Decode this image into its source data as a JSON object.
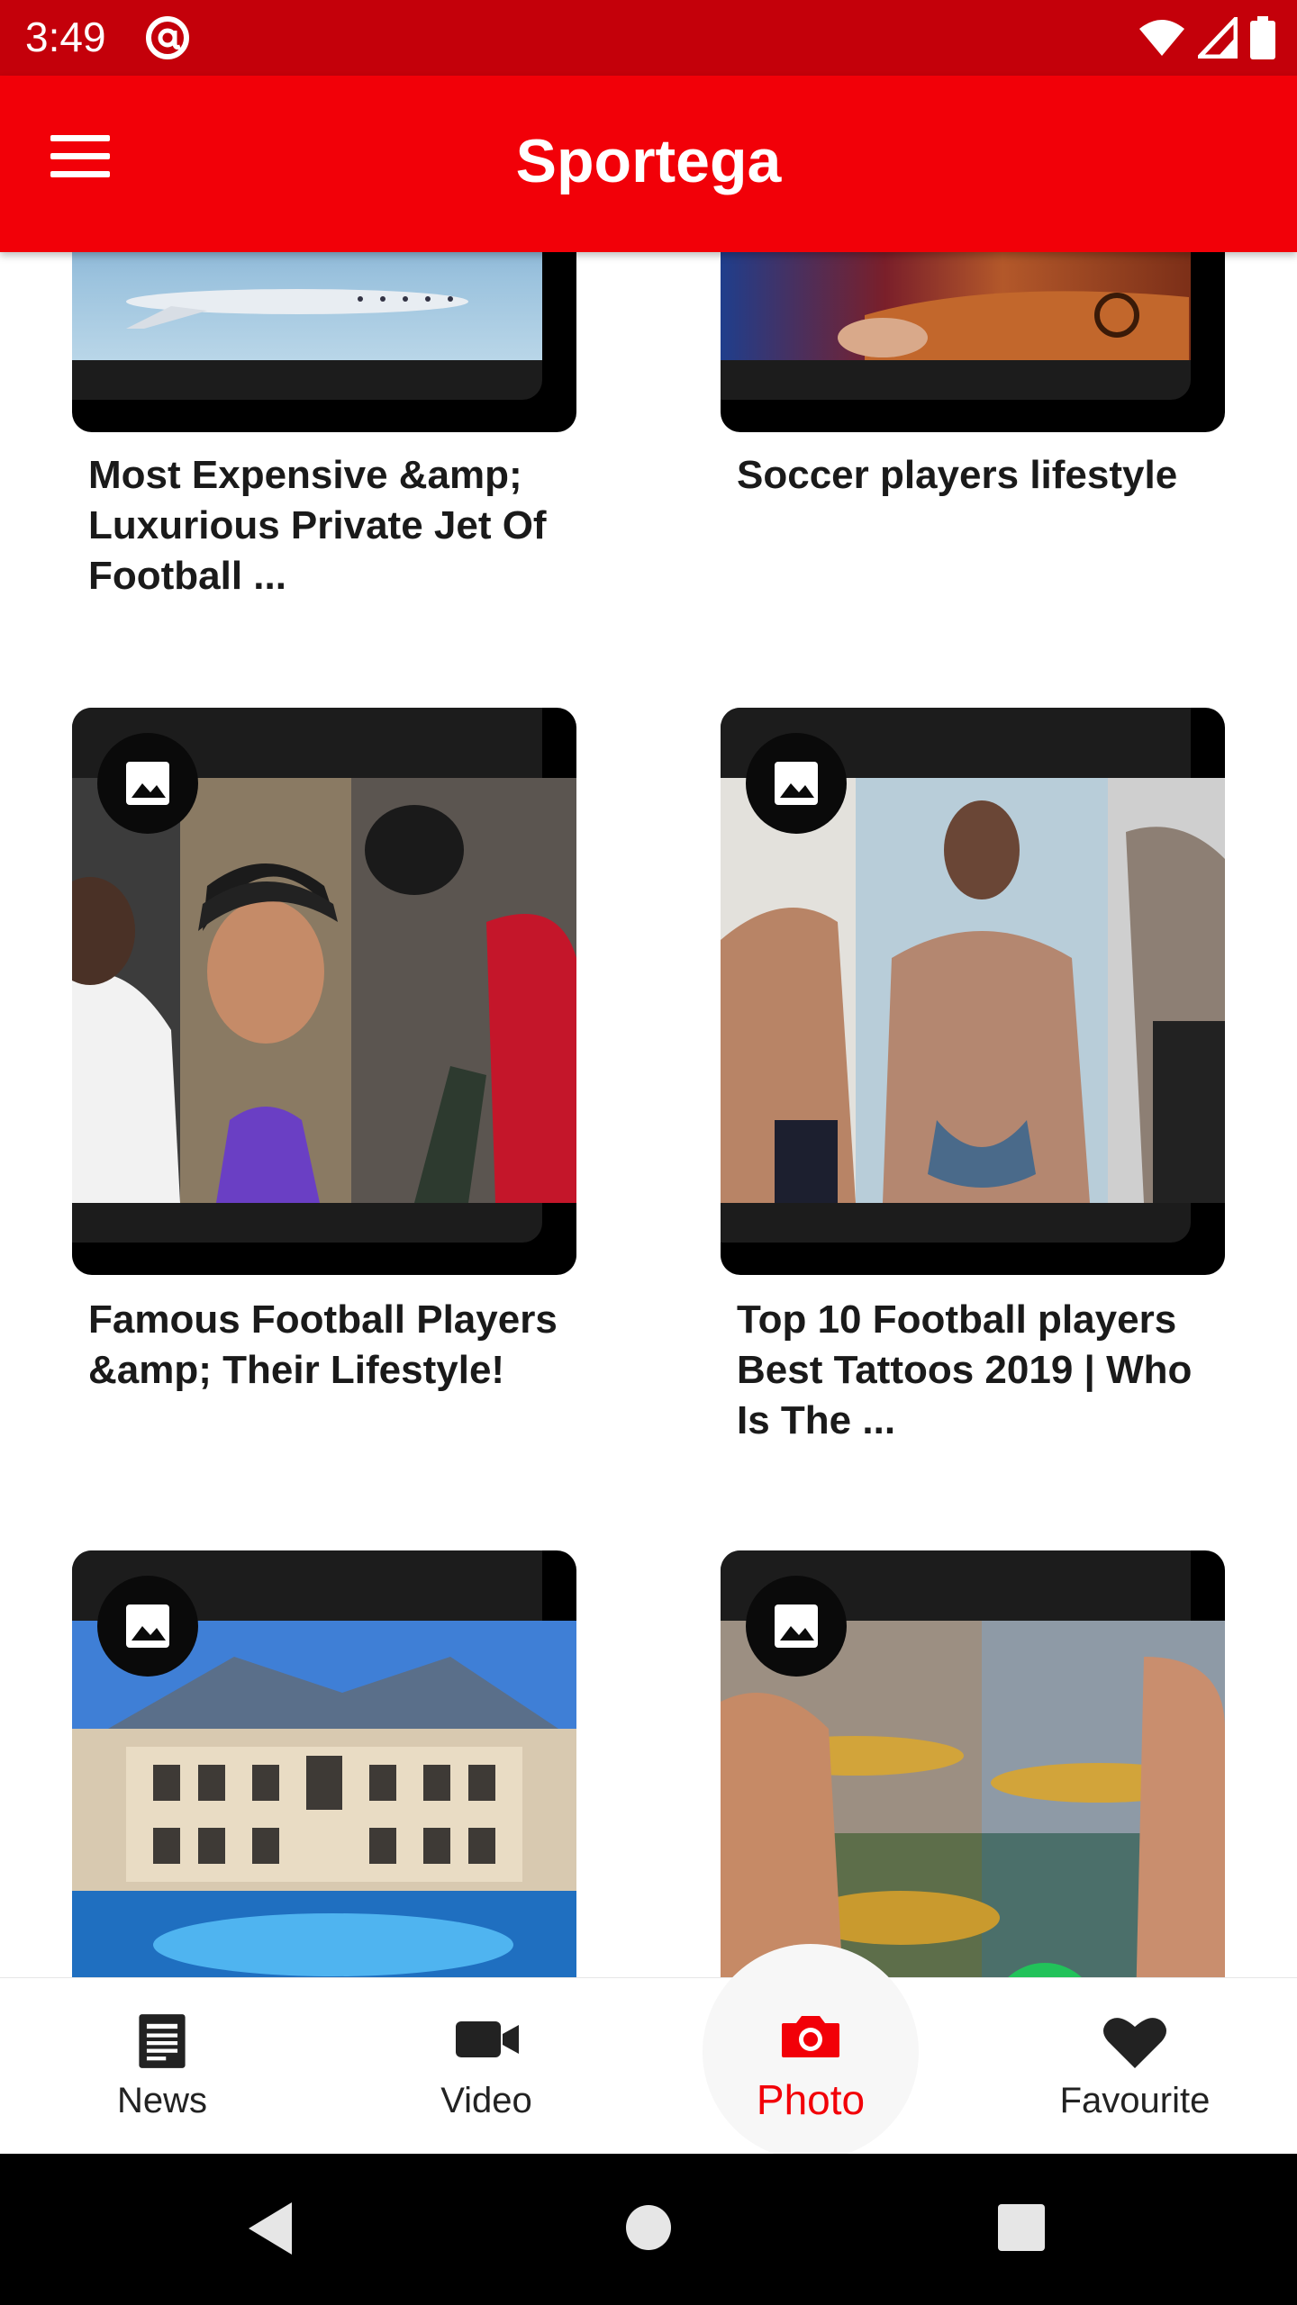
{
  "status_bar": {
    "time": "3:49"
  },
  "app_bar": {
    "title": "Sportega"
  },
  "cards": [
    {
      "title": "Most Expensive &amp; Luxurious Private Jet Of Football ...",
      "has_photo_badge": false
    },
    {
      "title": "Soccer players lifestyle",
      "has_photo_badge": false
    },
    {
      "title": "Famous Football Players &amp; Their Lifestyle!",
      "has_photo_badge": true
    },
    {
      "title": "Top 10 Football players Best Tattoos 2019 | Who Is The ...",
      "has_photo_badge": true
    },
    {
      "title": "",
      "has_photo_badge": true
    },
    {
      "title": "",
      "has_photo_badge": true
    }
  ],
  "bottom_nav": {
    "items": [
      {
        "label": "News",
        "icon": "news-icon",
        "active": false
      },
      {
        "label": "Video",
        "icon": "video-camera-icon",
        "active": false
      },
      {
        "label": "Photo",
        "icon": "photo-camera-icon",
        "active": true
      },
      {
        "label": "Favourite",
        "icon": "heart-icon",
        "active": false
      }
    ]
  },
  "colors": {
    "primary": "#f20008",
    "status_bar": "#c4000a",
    "active_nav": "#f20008"
  }
}
